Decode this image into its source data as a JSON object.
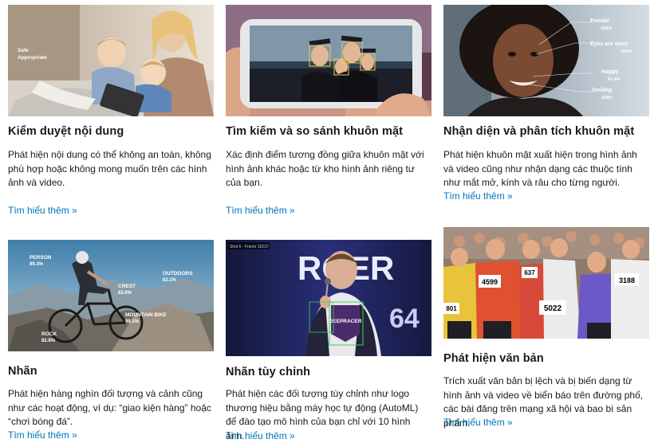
{
  "learn_more_label": "Tìm hiểu thêm »",
  "colors": {
    "link": "#0073bb",
    "text": "#16191f",
    "face_box": "#f2c94c",
    "label_box": "#39d353"
  },
  "cards": [
    {
      "title": "Kiểm duyệt nội dung",
      "description": "Phát hiện nội dung có thể không an toàn, không phù hợp hoặc không mong muốn trên các hình ảnh và video.",
      "image_icon": "mother-children-tablet-photo",
      "overlay": {
        "line1": "Safe",
        "line2": "Appropriate"
      }
    },
    {
      "title": "Tìm kiếm và so sánh khuôn mặt",
      "description": "Xác định điểm tương đồng giữa khuôn mặt với hình ảnh khác hoặc từ kho hình ảnh riêng tư của bạn.",
      "image_icon": "graduation-selfie-phone-photo"
    },
    {
      "title": "Nhận diện và phân tích khuôn mặt",
      "description": "Phát hiện khuôn mặt xuất hiện trong hình ảnh và video cũng như nhận dạng các thuộc tính như mắt mở, kính và râu cho từng người.",
      "image_icon": "smiling-woman-portrait-photo",
      "attributes": [
        {
          "label": "Female",
          "value": "100%"
        },
        {
          "label": "Eyes are open",
          "value": "100%"
        },
        {
          "label": "Happy",
          "value": "97.4%"
        },
        {
          "label": "Smiling",
          "value": "100%"
        }
      ]
    },
    {
      "title": "Nhãn",
      "description": "Phát hiện hàng nghìn đối tượng và cảnh cũng như các hoạt động, ví dụ: “giao kiện hàng” hoặc “chơi bóng đá”.",
      "image_icon": "mountain-biker-photo",
      "labels": [
        {
          "label": "PERSON",
          "value": "99.3%"
        },
        {
          "label": "OUTDOORS",
          "value": "83.1%"
        },
        {
          "label": "CREST",
          "value": "83.0%"
        },
        {
          "label": "MOUNTAIN BIKE",
          "value": "99.1%"
        },
        {
          "label": "ROCK",
          "value": "82.8%"
        }
      ]
    },
    {
      "title": "Nhãn tùy chỉnh",
      "description": "Phát hiện các đối tượng tùy chỉnh như logo thương hiệu bằng máy học tự động (AutoML) để đào tạo mô hình của bạn chỉ với 10 hình ảnh.",
      "image_icon": "deepracer-speaker-photo",
      "frame_label": "Shot 6 · Frame 15237",
      "backdrop_text": "RGER",
      "backdrop_digits": "64",
      "logo_text": "DEEPRACER"
    },
    {
      "title": "Phát hiện văn bản",
      "description": "Trích xuất văn bản bị lệch và bị biến dạng từ hình ảnh và video về biển báo trên đường phố, các bài đăng trên mạng xã hội và bao bì sản phẩm.",
      "image_icon": "marathon-runners-photo",
      "bibs": [
        "4599",
        "637",
        "3188",
        "5022",
        "801"
      ]
    }
  ]
}
